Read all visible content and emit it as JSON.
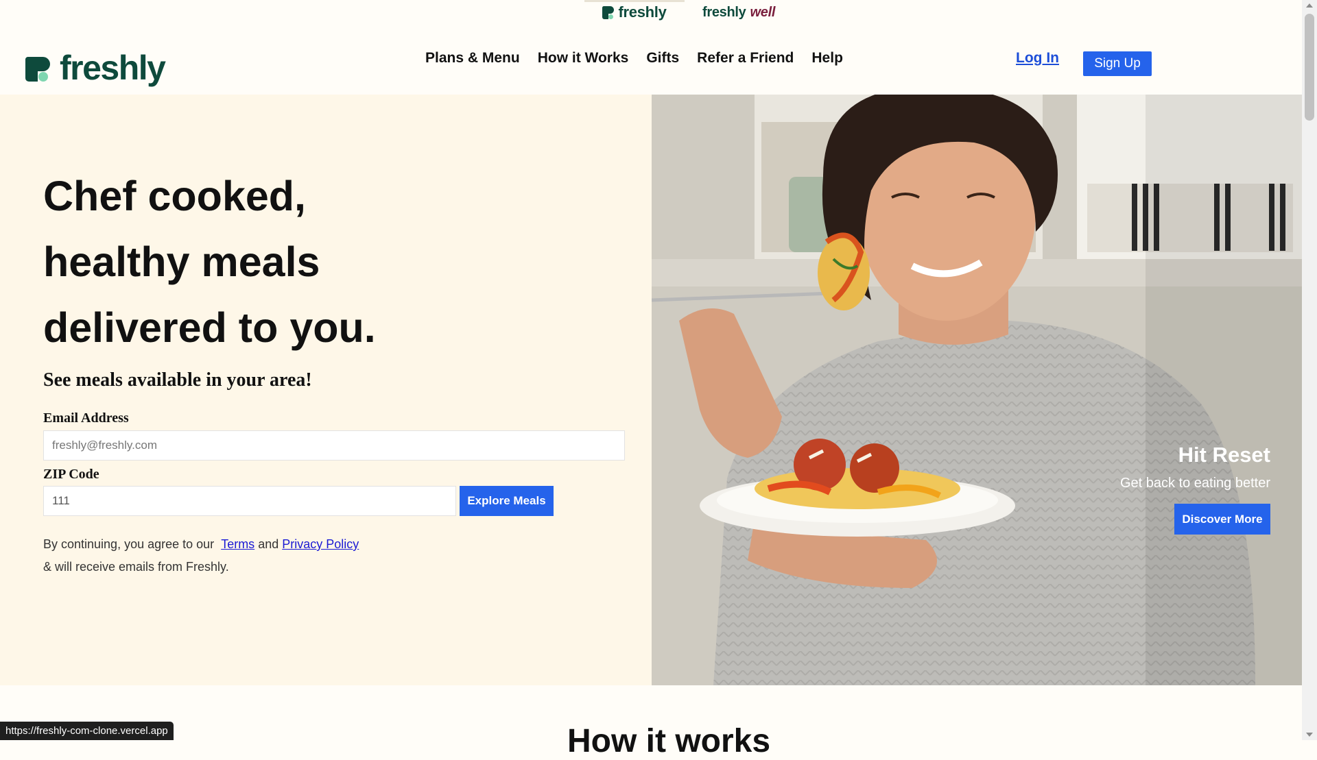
{
  "brand_strip": {
    "freshly_label": "freshly",
    "freshlywell_prefix": "freshly",
    "freshlywell_suffix": "well"
  },
  "header": {
    "logo_text": "freshly",
    "nav": [
      "Plans & Menu",
      "How it Works",
      "Gifts",
      "Refer a Friend",
      "Help"
    ],
    "login_label": "Log In",
    "signup_label": "Sign Up"
  },
  "hero": {
    "title_line1": "Chef cooked,",
    "title_line2": "healthy meals",
    "title_line3": "delivered to you.",
    "subtitle": "See meals available in your area!",
    "email_label": "Email Address",
    "email_placeholder": "freshly@freshly.com",
    "zip_label": "ZIP Code",
    "zip_value": "111",
    "explore_label": "Explore Meals",
    "consent_prefix": "By continuing, you agree to our",
    "terms_label": "Terms",
    "consent_and": "and",
    "privacy_label": "Privacy Policy",
    "consent_suffix": "& will receive emails from Freshly."
  },
  "promo": {
    "title": "Hit Reset",
    "subtitle": "Get back to eating better",
    "button_label": "Discover More"
  },
  "how_it_works": {
    "heading": "How it works"
  },
  "status_bar": {
    "url": "https://freshly-com-clone.vercel.app"
  },
  "colors": {
    "brand_green": "#0e4a3c",
    "brand_mint": "#7fd6b0",
    "accent_blue": "#2563eb",
    "hero_left_bg": "#fef7e8",
    "page_bg": "#fffdf8"
  }
}
